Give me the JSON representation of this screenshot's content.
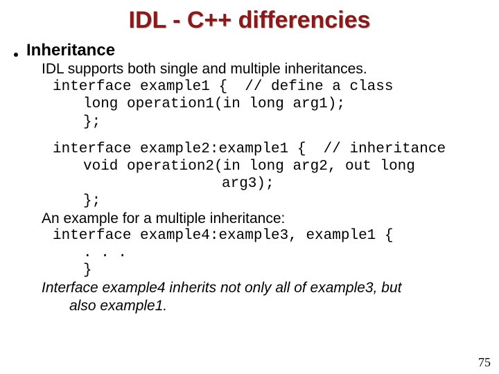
{
  "title": "IDL - C++ differencies",
  "bullet": "Inheritance",
  "intro": "IDL supports both single and multiple inheritances.",
  "code1_l1": "interface example1 {  // define a class",
  "code1_l2": "long operation1(in long arg1);",
  "code1_l3": "};",
  "code2_l1": "interface example2:example1 {  // inheritance",
  "code2_l2": "void operation2(in long arg2, out long",
  "code2_l3": "arg3);",
  "code2_l4": "};",
  "multi_label": "An example for a multiple inheritance:",
  "code3_l1": "interface example4:example3, example1 {",
  "code3_l2": ". . .",
  "code3_l3": "}",
  "conclusion_a": "Interface example4 inherits not only all of example3, but",
  "conclusion_b": "also example1.",
  "page": "75"
}
